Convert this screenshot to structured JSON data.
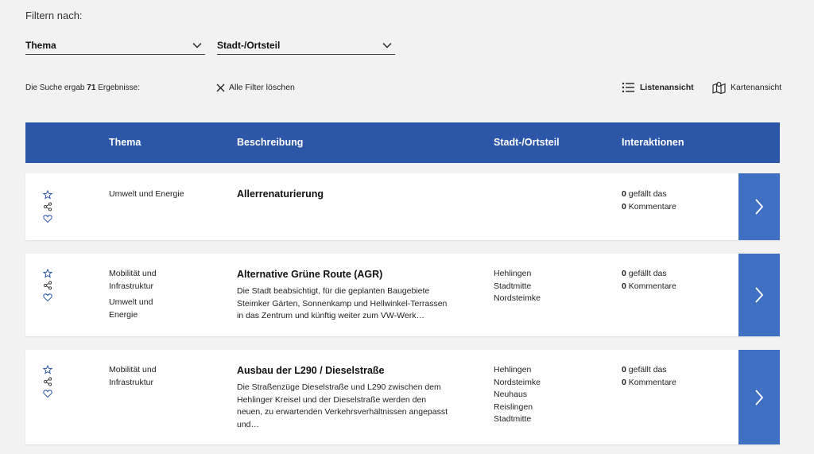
{
  "filter": {
    "label": "Filtern nach:",
    "thema_select": "Thema",
    "stadt_select": "Stadt-/Ortsteil"
  },
  "results": {
    "prefix": "Die Suche ergab",
    "count": "71",
    "suffix": "Ergebnisse:"
  },
  "clear_filters": "Alle Filter löschen",
  "views": {
    "list": "Listenansicht",
    "map": "Kartenansicht"
  },
  "table": {
    "headers": {
      "thema": "Thema",
      "beschreibung": "Beschreibung",
      "stadt": "Stadt-/Ortsteil",
      "interaktionen": "Interaktionen"
    },
    "rows": [
      {
        "thema": [
          "Umwelt und Energie"
        ],
        "title": "Allerrenaturierung",
        "desc": "",
        "stadt": [],
        "likes": "0",
        "likes_label": "gefällt das",
        "comments": "0",
        "comments_label": "Kommentare"
      },
      {
        "thema": [
          "Mobilität und Infrastruktur",
          "Umwelt und Energie"
        ],
        "title": "Alternative Grüne Route (AGR)",
        "desc": "Die Stadt beabsichtigt, für die geplanten Baugebiete Steimker Gärten, Sonnenkamp und Hellwinkel-Terrassen in das Zentrum und künftig weiter zum VW-Werk…",
        "stadt": [
          "Hehlingen",
          "Stadtmitte",
          "Nordsteimke"
        ],
        "likes": "0",
        "likes_label": "gefällt das",
        "comments": "0",
        "comments_label": "Kommentare"
      },
      {
        "thema": [
          "Mobilität und Infrastruktur"
        ],
        "title": "Ausbau der L290 / Dieselstraße",
        "desc": "Die Straßenzüge Dieselstraße und L290 zwischen dem Hehlinger Kreisel und der Dieselstraße werden den neuen, zu erwartenden Verkehrsverhältnissen angepasst und…",
        "stadt": [
          "Hehlingen",
          "Nordsteimke",
          "Neuhaus",
          "Reislingen",
          "Stadtmitte"
        ],
        "likes": "0",
        "likes_label": "gefällt das",
        "comments": "0",
        "comments_label": "Kommentare"
      }
    ]
  },
  "icons": {
    "favorite": "star-icon",
    "share": "share-icon",
    "like": "heart-icon",
    "open": "chevron-right-icon",
    "dropdown": "chevron-down-icon",
    "clear": "close-icon",
    "list_view": "list-icon",
    "map_view": "map-icon"
  },
  "colors": {
    "header_bg": "#2c56a8",
    "button_bg": "#4070c4",
    "icon_blue": "#2c56a8",
    "page_bg": "#f2f2f3"
  }
}
